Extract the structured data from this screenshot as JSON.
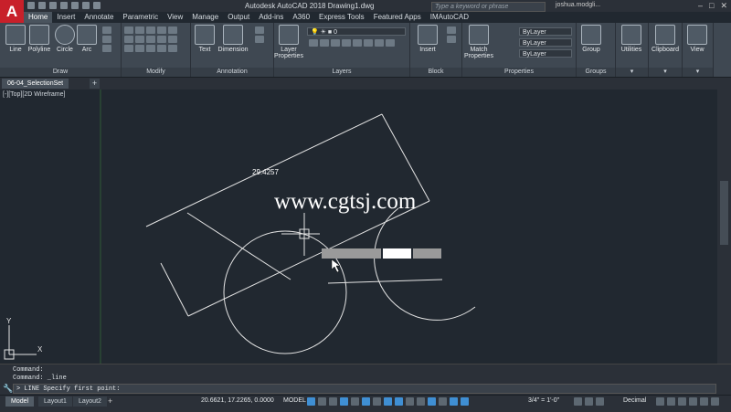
{
  "titlebar": {
    "app_letter": "A",
    "title": "Autodesk AutoCAD 2018    Drawing1.dwg",
    "search_placeholder": "Type a keyword or phrase",
    "user": "joshua.modgli..."
  },
  "ribbon_tabs": [
    "Home",
    "Insert",
    "Annotate",
    "Parametric",
    "View",
    "Manage",
    "Output",
    "Add-ins",
    "A360",
    "Express Tools",
    "Featured Apps",
    "IMAutoCAD"
  ],
  "ribbon": {
    "draw": {
      "title": "Draw",
      "tools": [
        "Line",
        "Polyline",
        "Circle",
        "Arc"
      ]
    },
    "modify": {
      "title": "Modify"
    },
    "annotation": {
      "title": "Annotation",
      "tools": [
        "Text",
        "Dimension"
      ]
    },
    "layers": {
      "title": "Layers",
      "tool": "Layer Properties",
      "layer_value": "0"
    },
    "block": {
      "title": "Block",
      "tool": "Insert"
    },
    "properties": {
      "title": "Properties",
      "tool": "Match Properties",
      "color": "ByLayer",
      "linetype": "ByLayer",
      "lineweight": "ByLayer"
    },
    "groups": {
      "title": "Groups",
      "tool": "Group"
    },
    "utilities": "Utilities",
    "clipboard": "Clipboard",
    "view": "View"
  },
  "file_tab": "06-04_SelectionSet",
  "viewport": {
    "label": "[-][Top][2D Wireframe]",
    "dimension_text": "29.4257",
    "watermark": "www.cgtsj.com",
    "ucs_y": "Y",
    "ucs_x": "X"
  },
  "command": {
    "history": [
      "Command:",
      "Command: _line"
    ],
    "prompt": "LINE Specify first point:"
  },
  "status": {
    "layout_tabs": [
      "Model",
      "Layout1",
      "Layout2"
    ],
    "coords": "20.6621, 17.2265, 0.0000",
    "mode": "MODEL",
    "scale": "3/4\" = 1'-0\"",
    "units": "Decimal"
  },
  "colors": {
    "canvas": "#212830",
    "ribbon": "#3f4852",
    "accent": "#3f8fd4",
    "app_button": "#c8202a"
  }
}
